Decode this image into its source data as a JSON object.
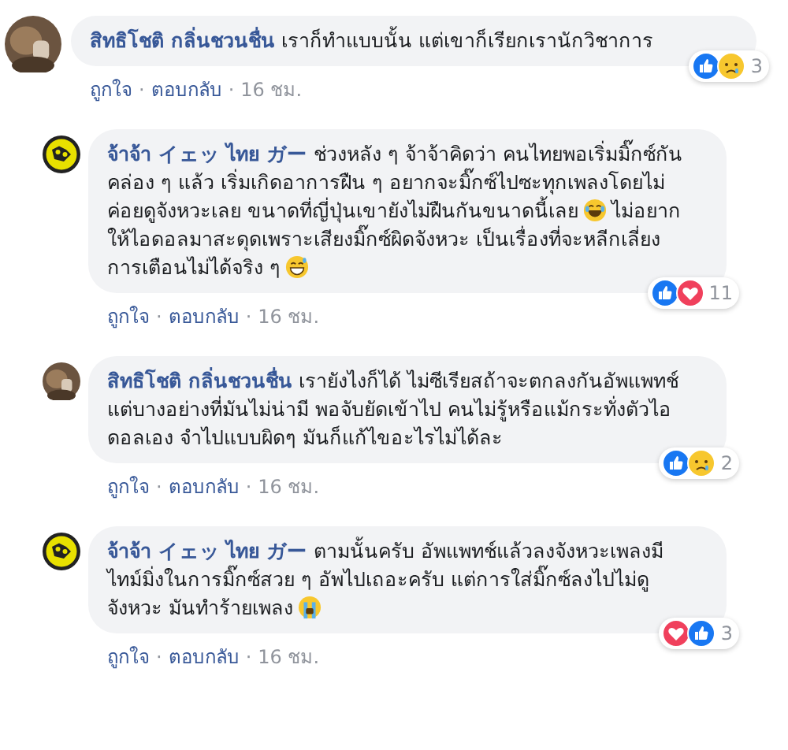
{
  "comments": [
    {
      "author": "สิทธิโชติ กลิ่นชวนชื่น",
      "avatar": {
        "kind": "photo"
      },
      "reply": false,
      "body": [
        {
          "kind": "text",
          "text": "เราก็ทำแบบนั้น แต่เขาก็เรียกเรานักวิชาการ"
        }
      ],
      "reactions": [
        {
          "kind": "like"
        },
        {
          "kind": "sad"
        }
      ],
      "count": "3",
      "actions": [
        {
          "kind": "link",
          "text": "ถูกใจ"
        },
        {
          "kind": "dot",
          "text": "·"
        },
        {
          "kind": "link",
          "text": "ตอบกลับ"
        },
        {
          "kind": "dot",
          "text": "·"
        },
        {
          "kind": "time",
          "text": "16 ชม."
        }
      ]
    },
    {
      "author": "จ้าจ้า イェッ ไทย ガー",
      "avatar": {
        "kind": "logo"
      },
      "reply": true,
      "body": [
        {
          "kind": "text",
          "text": "ช่วงหลัง ๆ จ้าจ้าคิดว่า คนไทยพอเริ่มมิ๊กซ์กันคล่อง ๆ แล้ว เริ่มเกิดอาการฝืน ๆ อยากจะมิ๊กซ์ไปซะทุกเพลงโดยไม่ค่อยดูจังหวะเลย ขนาดที่ญี่ปุ่นเขายังไม่ฝืนกันขนาดนี้เลย"
        },
        {
          "kind": "laughing"
        },
        {
          "kind": "text",
          "text": "ไม่อยากให้ไอดอลมาสะดุดเพราะเสียงมิ๊กซ์ผิดจังหวะ เป็นเรื่องที่จะหลีกเลี่ยงการเตือนไม่ได้จริง ๆ"
        },
        {
          "kind": "grinning"
        }
      ],
      "reactions": [
        {
          "kind": "like"
        },
        {
          "kind": "love"
        }
      ],
      "count": "11",
      "actions": [
        {
          "kind": "link",
          "text": "ถูกใจ"
        },
        {
          "kind": "dot",
          "text": "·"
        },
        {
          "kind": "link",
          "text": "ตอบกลับ"
        },
        {
          "kind": "dot",
          "text": "·"
        },
        {
          "kind": "time",
          "text": "16 ชม."
        }
      ]
    },
    {
      "author": "สิทธิโชติ กลิ่นชวนชื่น",
      "avatar": {
        "kind": "photo"
      },
      "reply": true,
      "body": [
        {
          "kind": "text",
          "text": "เรายังไงก็ได้ ไม่ซีเรียสถ้าจะตกลงกันอัพแพทช์"
        },
        {
          "kind": "break"
        },
        {
          "kind": "text",
          "text": "แต่บางอย่างที่มันไม่น่ามี พอจับยัดเข้าไป คนไม่รู้หรือแม้กระทั่งตัวไอดอลเอง จำไปแบบผิดๆ มันก็แก้ไขอะไรไม่ได้ละ"
        }
      ],
      "reactions": [
        {
          "kind": "like"
        },
        {
          "kind": "sad"
        }
      ],
      "count": "2",
      "actions": [
        {
          "kind": "link",
          "text": "ถูกใจ"
        },
        {
          "kind": "dot",
          "text": "·"
        },
        {
          "kind": "link",
          "text": "ตอบกลับ"
        },
        {
          "kind": "dot",
          "text": "·"
        },
        {
          "kind": "time",
          "text": "16 ชม."
        }
      ]
    },
    {
      "author": "จ้าจ้า イェッ ไทย ガー",
      "avatar": {
        "kind": "logo"
      },
      "reply": true,
      "body": [
        {
          "kind": "text",
          "text": "ตามนั้นครับ อัพแพทช์แล้วลงจังหวะเพลงมีไทม์มิ่งในการมิ๊กซ์สวย ๆ อัพไปเถอะครับ แต่การใส่มิ๊กซ์ลงไปไม่ดูจังหวะ มันทำร้ายเพลง"
        },
        {
          "kind": "crying"
        }
      ],
      "reactions": [
        {
          "kind": "love"
        },
        {
          "kind": "like"
        }
      ],
      "count": "3",
      "actions": [
        {
          "kind": "link",
          "text": "ถูกใจ"
        },
        {
          "kind": "dot",
          "text": "·"
        },
        {
          "kind": "link",
          "text": "ตอบกลับ"
        },
        {
          "kind": "dot",
          "text": "·"
        },
        {
          "kind": "time",
          "text": "16 ชม."
        }
      ]
    }
  ]
}
